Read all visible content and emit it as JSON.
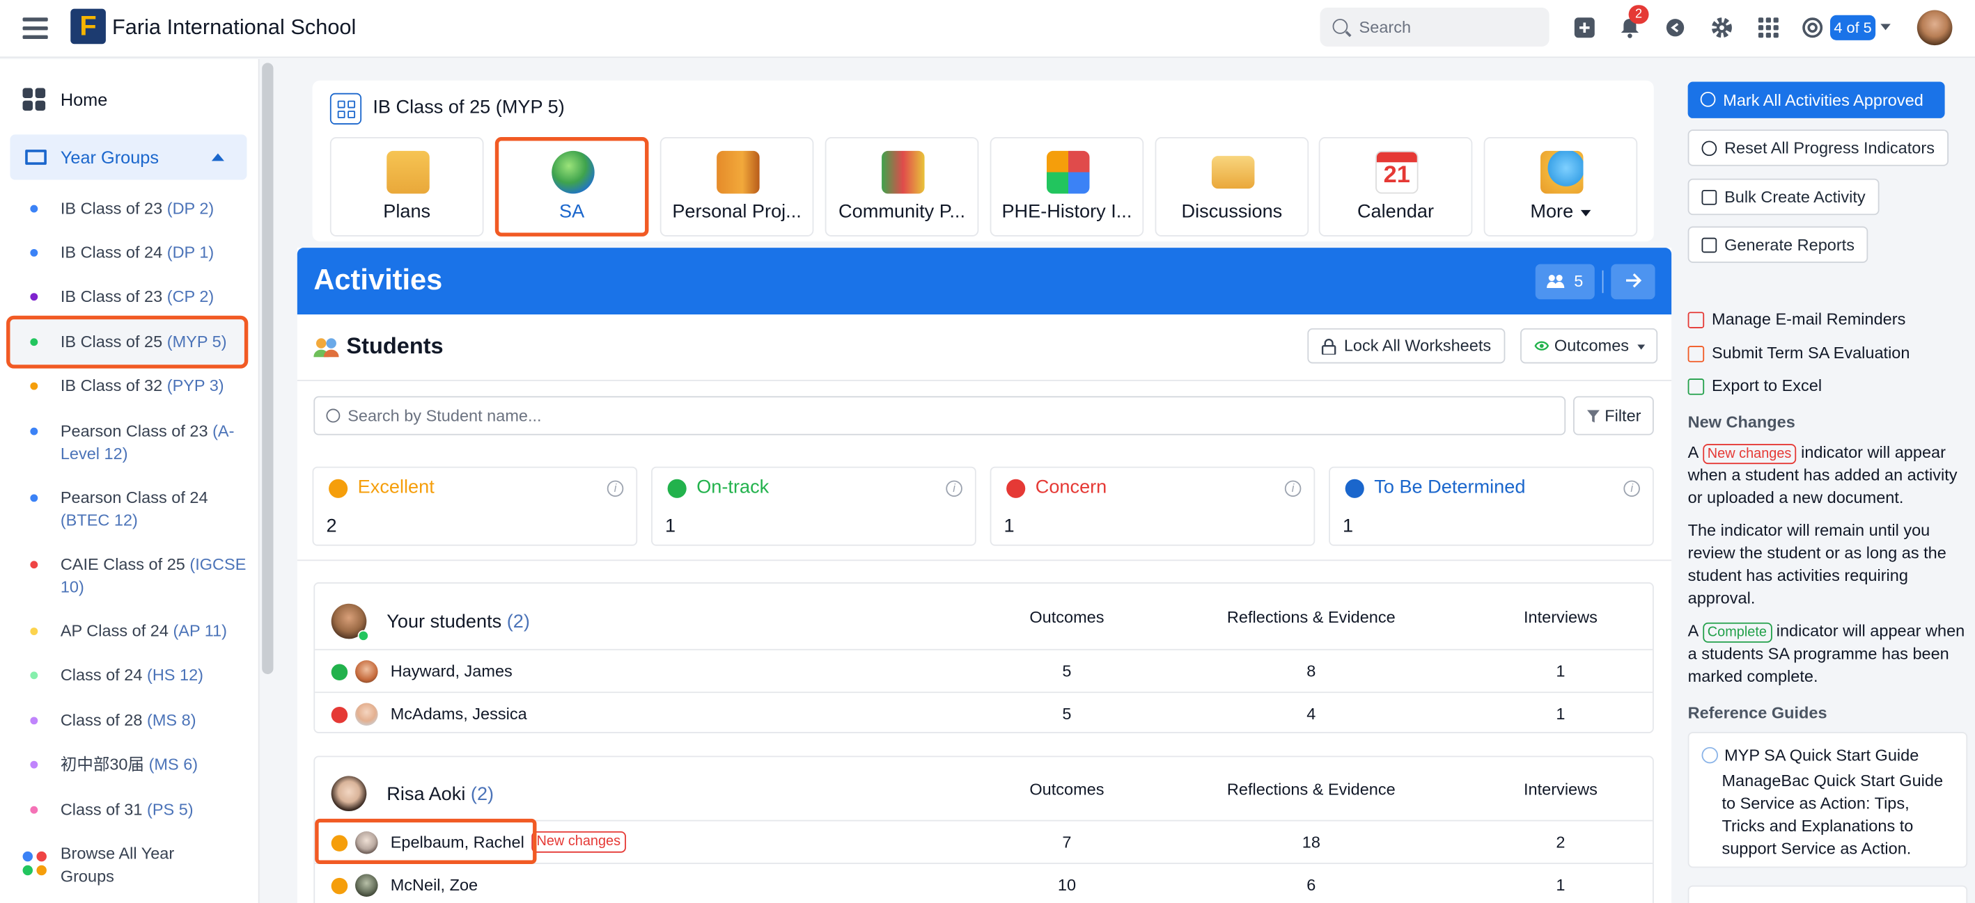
{
  "header": {
    "school_name": "Faria International School",
    "logo_letter": "F",
    "search_placeholder": "Search",
    "notification_count": "2",
    "pager": "4 of 5"
  },
  "sidebar": {
    "home": "Home",
    "year_groups": "Year Groups",
    "items": [
      {
        "name": "IB Class of 23 ",
        "code": "(DP 2)",
        "color": "#3b82f6"
      },
      {
        "name": "IB Class of 24 ",
        "code": "(DP 1)",
        "color": "#3b82f6"
      },
      {
        "name": "IB Class of 23 ",
        "code": "(CP 2)",
        "color": "#7e22ce"
      },
      {
        "name": "IB Class of 25 ",
        "code": "(MYP 5)",
        "color": "#22c55e"
      },
      {
        "name": "IB Class of 32 ",
        "code": "(PYP 3)",
        "color": "#f59e0b"
      },
      {
        "name": "Pearson Class of 23 ",
        "code": "(A-Level 12)",
        "color": "#3b82f6"
      },
      {
        "name": "Pearson Class of 24 ",
        "code": "(BTEC 12)",
        "color": "#3b82f6"
      },
      {
        "name": "CAIE Class of 25 ",
        "code": "(IGCSE 10)",
        "color": "#ef4444"
      },
      {
        "name": "AP Class of 24 ",
        "code": "(AP 11)",
        "color": "#fcd34d"
      },
      {
        "name": "Class of 24 ",
        "code": "(HS 12)",
        "color": "#86efac"
      },
      {
        "name": "Class of 28 ",
        "code": "(MS 8)",
        "color": "#c084fc"
      },
      {
        "name": "初中部30届 ",
        "code": "(MS 6)",
        "color": "#c084fc"
      },
      {
        "name": "Class of 31 ",
        "code": "(PS 5)",
        "color": "#f472b6"
      }
    ],
    "browse": "Browse All Year Groups"
  },
  "class_card": {
    "title": "IB Class of 25 (MYP 5)",
    "tiles": [
      "Plans",
      "SA",
      "Personal Proj...",
      "Community P...",
      "PHE-History I...",
      "Discussions",
      "Calendar",
      "More"
    ],
    "calendar_day": "21"
  },
  "activities": {
    "title": "Activities",
    "count": "5",
    "students_heading": "Students",
    "lock_button": "Lock All Worksheets",
    "outcomes_button": "Outcomes",
    "search_placeholder": "Search by Student name...",
    "filter_button": "Filter",
    "stats": [
      {
        "label": "Excellent",
        "value": "2",
        "color": "#f59e0b"
      },
      {
        "label": "On-track",
        "value": "1",
        "color": "#22b24c"
      },
      {
        "label": "Concern",
        "value": "1",
        "color": "#e53935"
      },
      {
        "label": "To Be Determined",
        "value": "1",
        "color": "#1a66cc"
      }
    ],
    "columns": [
      "Outcomes",
      "Reflections & Evidence",
      "Interviews"
    ],
    "groups": [
      {
        "name": "Your students",
        "count": "(2)",
        "rows": [
          {
            "name": "Hayward, James",
            "outcomes": "5",
            "reflections": "8",
            "interviews": "1"
          },
          {
            "name": "McAdams, Jessica",
            "outcomes": "5",
            "reflections": "4",
            "interviews": "1"
          }
        ]
      },
      {
        "name": "Risa Aoki",
        "count": "(2)",
        "rows": [
          {
            "name": "Epelbaum, Rachel",
            "badge": "New changes",
            "outcomes": "7",
            "reflections": "18",
            "interviews": "2"
          },
          {
            "name": "McNeil, Zoe",
            "outcomes": "10",
            "reflections": "6",
            "interviews": "1"
          }
        ]
      }
    ]
  },
  "right_panel": {
    "mark_all": "Mark All Activities Approved",
    "reset": "Reset All Progress Indicators",
    "bulk": "Bulk Create Activity",
    "reports": "Generate Reports",
    "links": [
      "Manage E-mail Reminders",
      "Submit Term SA Evaluation",
      "Export to Excel"
    ],
    "new_changes_heading": "New Changes",
    "nc_text1_a": "A ",
    "nc_pill": "New changes",
    "nc_text1_b": " indicator will appear when a student has added an activity or uploaded a new document.",
    "nc_text2": "The indicator will remain until you review the student or as long as the student has activities requiring approval.",
    "c_text_a": "A ",
    "c_pill": "Complete",
    "c_text_b": " indicator will appear when a students SA programme has been marked complete.",
    "ref_heading": "Reference Guides",
    "guide_title": "MYP SA Quick Start Guide",
    "guide_desc": "ManageBac Quick Start Guide to Service as Action: Tips, Tricks and Explanations to support Service as Action."
  }
}
